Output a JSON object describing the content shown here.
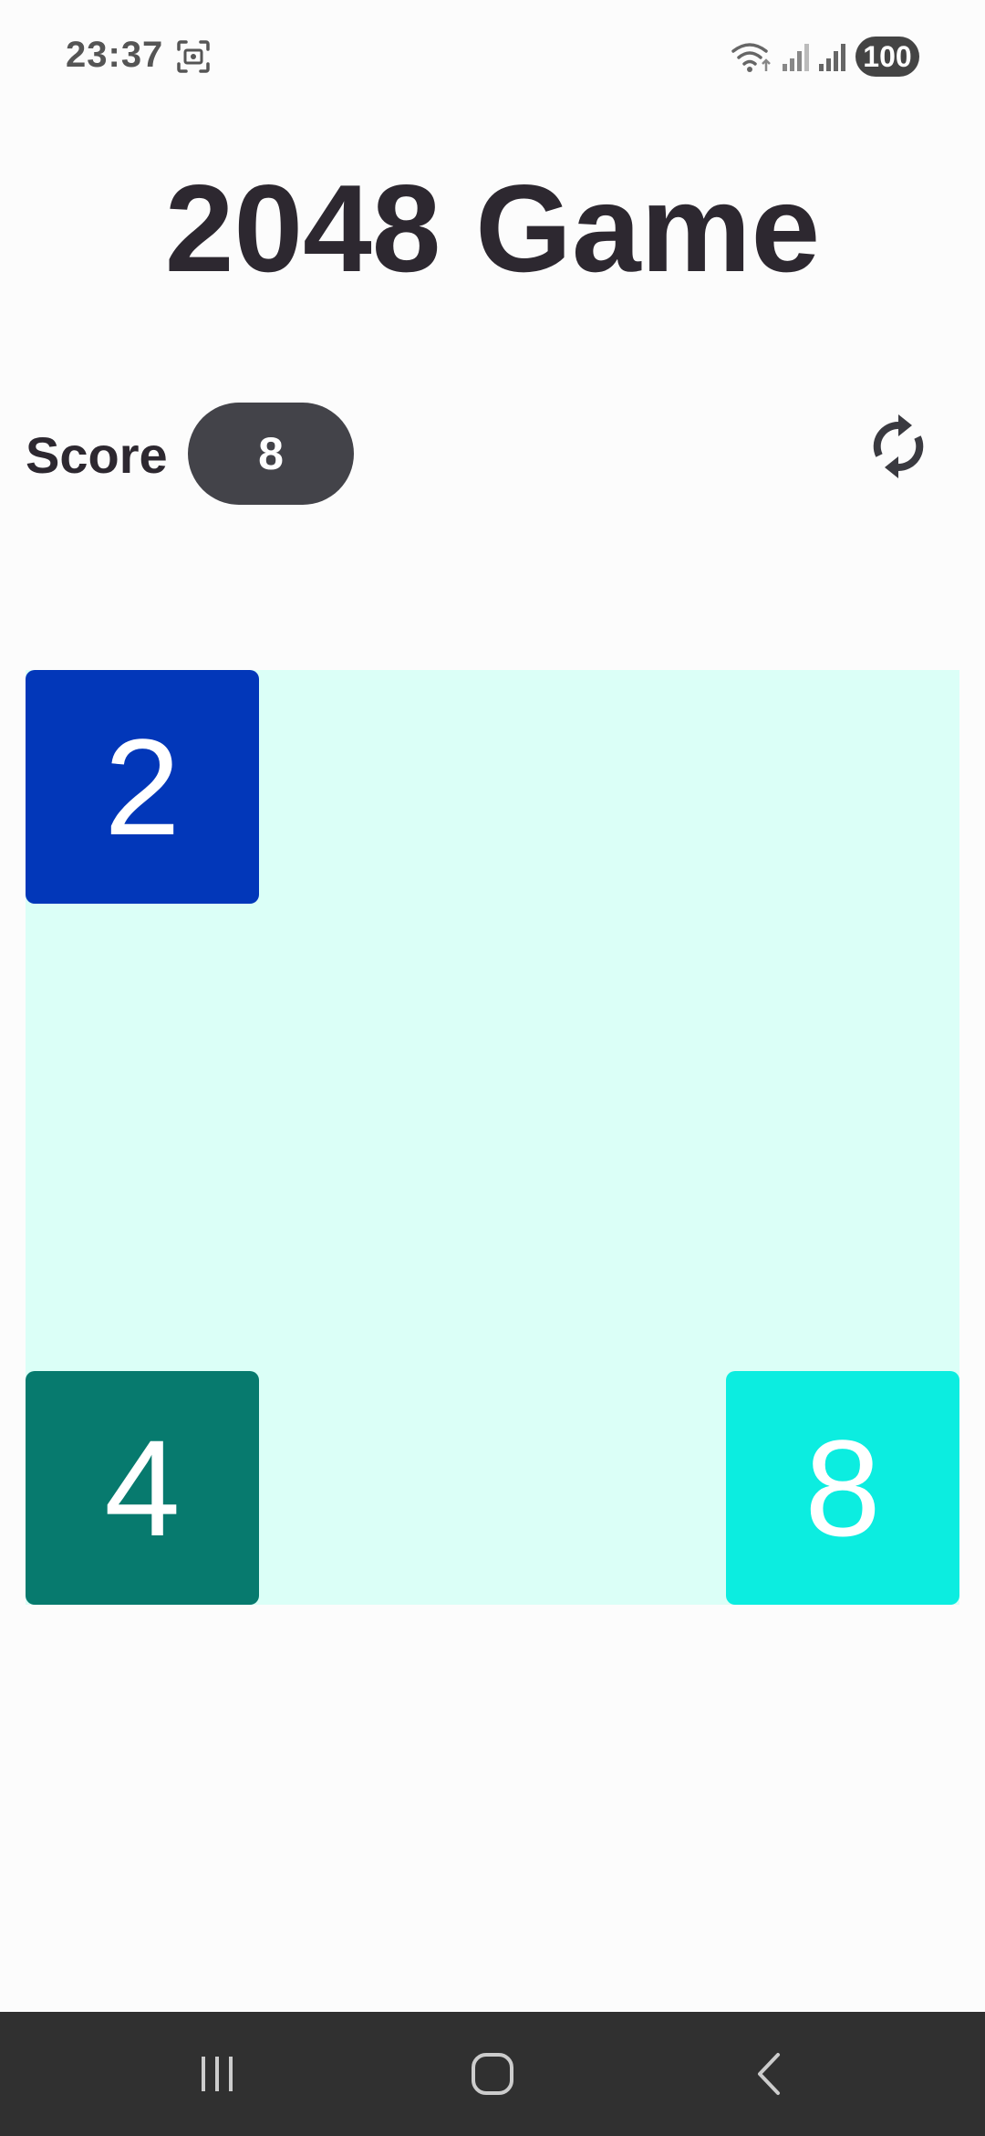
{
  "status_bar": {
    "time": "23:37",
    "battery": "100",
    "icons": [
      "screenshot-icon",
      "wifi-icon",
      "signal-icon",
      "signal-icon",
      "battery-icon"
    ]
  },
  "header": {
    "title": "2048 Game"
  },
  "score": {
    "label": "Score",
    "value": "8"
  },
  "controls": {
    "restart_icon": "refresh-icon"
  },
  "board": {
    "grid_size": 4,
    "background_color": "#dbfff7",
    "tiles": [
      {
        "value": "2",
        "row": 0,
        "col": 0,
        "color": "#0237b9"
      },
      {
        "value": "4",
        "row": 3,
        "col": 0,
        "color": "#077a6e"
      },
      {
        "value": "8",
        "row": 3,
        "col": 3,
        "color": "#0cede0"
      }
    ]
  },
  "nav_bar": {
    "buttons": [
      "recent-apps-icon",
      "home-icon",
      "back-icon"
    ]
  },
  "colors": {
    "title_text": "#2d2830",
    "score_pill": "#434349",
    "nav_bar": "#303030"
  }
}
